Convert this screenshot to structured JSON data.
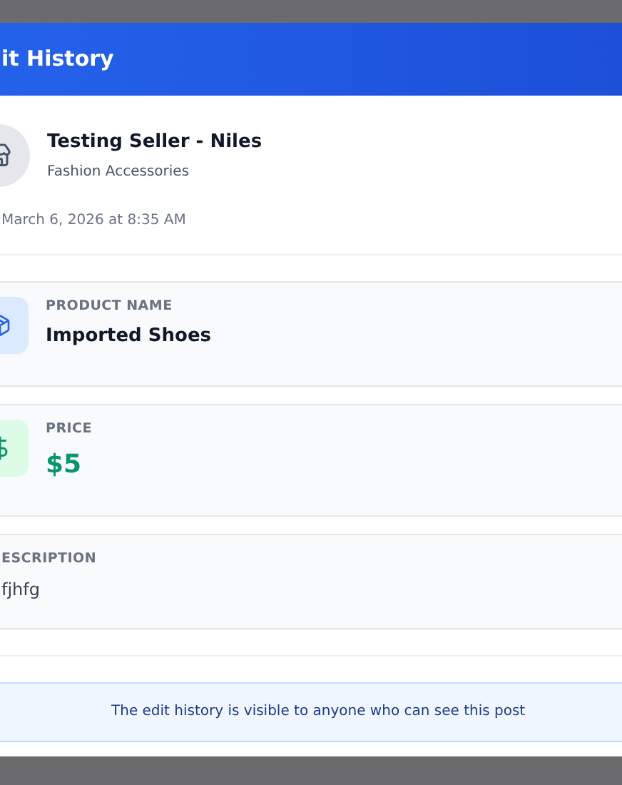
{
  "dialog": {
    "title": "it History"
  },
  "seller": {
    "name": "Testing Seller - Niles",
    "category": "Fashion Accessories"
  },
  "timestamp": "March 6, 2026 at 8:35 AM",
  "fields": [
    {
      "kind": "name",
      "label": "PRODUCT NAME",
      "value": "Imported Shoes"
    },
    {
      "kind": "price",
      "label": "PRICE",
      "value": "$5"
    },
    {
      "kind": "text",
      "label": "ESCRIPTION",
      "value": "fjhfg"
    }
  ],
  "notice": "The edit history is visible to anyone who can see this post"
}
